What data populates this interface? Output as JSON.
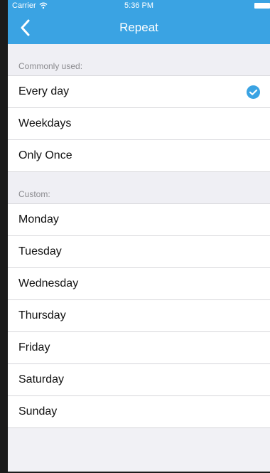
{
  "status": {
    "carrier": "Carrier",
    "time": "5:36 PM"
  },
  "nav": {
    "title": "Repeat",
    "back_icon": "chevron-left-icon"
  },
  "colors": {
    "accent": "#3aa3e3",
    "check": "#3aa3e3",
    "background": "#efeff4"
  },
  "common": {
    "header": "Commonly used:",
    "items": [
      {
        "label": "Every day",
        "checked": true
      },
      {
        "label": "Weekdays",
        "checked": false
      },
      {
        "label": "Only Once",
        "checked": false
      }
    ]
  },
  "custom": {
    "header": "Custom:",
    "items": [
      {
        "label": "Monday"
      },
      {
        "label": "Tuesday"
      },
      {
        "label": "Wednesday"
      },
      {
        "label": "Thursday"
      },
      {
        "label": "Friday"
      },
      {
        "label": "Saturday"
      },
      {
        "label": "Sunday"
      }
    ]
  }
}
